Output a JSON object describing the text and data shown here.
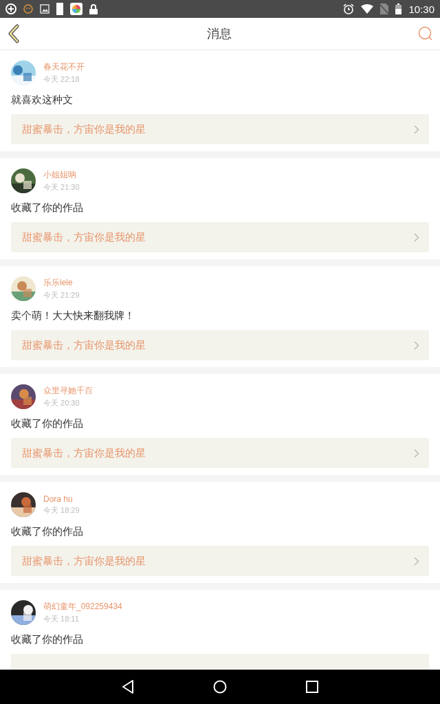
{
  "status_bar": {
    "time": "10:30"
  },
  "header": {
    "title": "消息"
  },
  "messages": [
    {
      "name": "春天花不开",
      "time": "今天 22:18",
      "text": "就喜欢这种文",
      "link": "甜蜜暴击，方宙你是我的星",
      "kind": "picture"
    },
    {
      "name": "小姐姐呐",
      "time": "今天 21:30",
      "text": "收藏了你的作品",
      "link": "甜蜜暴击，方宙你是我的星",
      "kind": "picture"
    },
    {
      "name": "乐乐lele",
      "time": "今天 21:29",
      "text": "卖个萌！大大快来翻我牌！",
      "link": "甜蜜暴击，方宙你是我的星",
      "kind": "picture"
    },
    {
      "name": "众里寻她千百",
      "time": "今天 20:30",
      "text": "收藏了你的作品",
      "link": "甜蜜暴击，方宙你是我的星",
      "kind": "picture"
    },
    {
      "name": "Dora hu",
      "time": "今天 18:29",
      "text": "收藏了你的作品",
      "link": "甜蜜暴击，方宙你是我的星",
      "kind": "picture"
    },
    {
      "name": "萌幻童年_092259434",
      "time": "今天 18:11",
      "text": "收藏了你的作品",
      "kind": "picture"
    }
  ]
}
